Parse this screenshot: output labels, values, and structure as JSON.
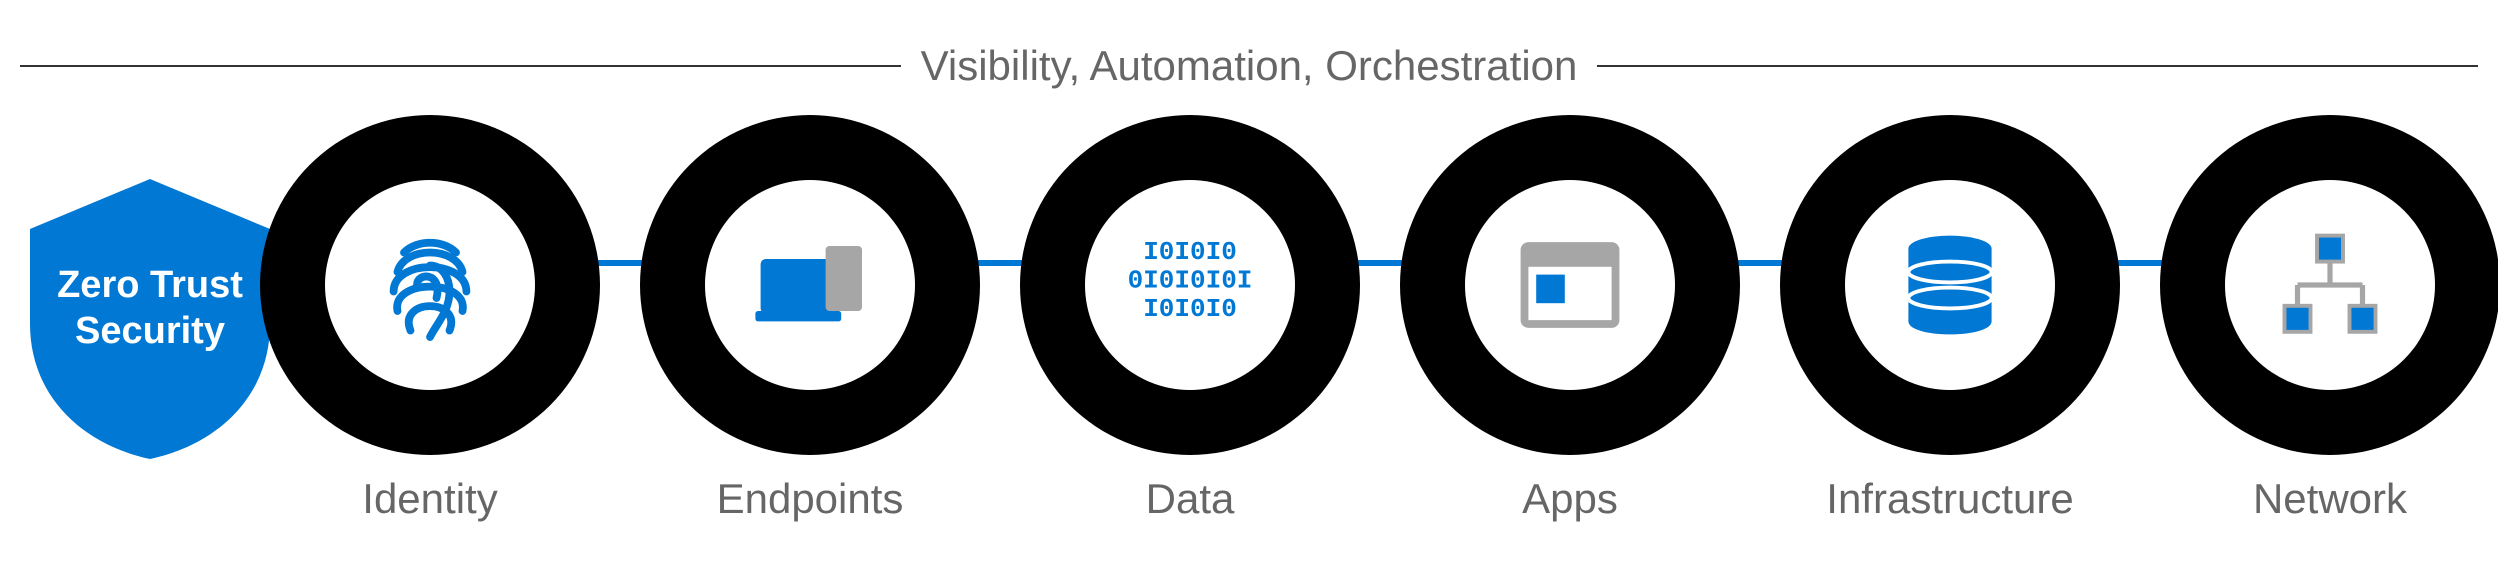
{
  "header": {
    "title": "Visibility, Automation, Orchestration"
  },
  "shield": {
    "line1": "Zero Trust",
    "line2": "Security"
  },
  "pillars": [
    {
      "label": "Identity",
      "icon": "fingerprint-icon"
    },
    {
      "label": "Endpoints",
      "icon": "devices-icon"
    },
    {
      "label": "Data",
      "icon": "binary-icon"
    },
    {
      "label": "Apps",
      "icon": "window-icon"
    },
    {
      "label": "Infrastructure",
      "icon": "database-icon"
    },
    {
      "label": "Network",
      "icon": "network-icon"
    }
  ],
  "colors": {
    "primary": "#0078d4",
    "secondary": "#a6a6a6",
    "text": "#666666",
    "ring": "#000000"
  }
}
